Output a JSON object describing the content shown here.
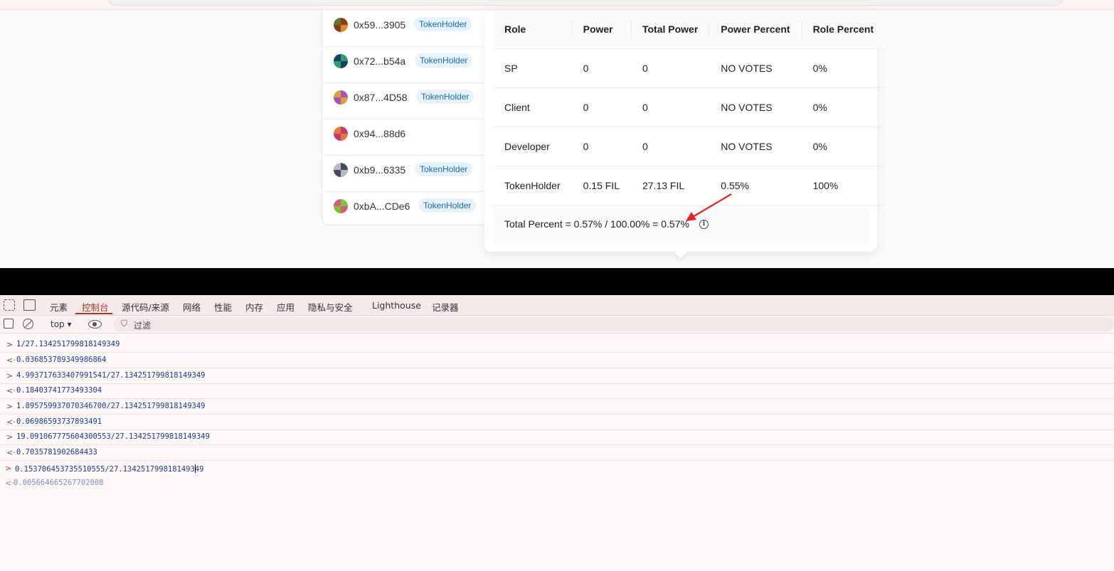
{
  "voters": [
    {
      "address": "0x59...3905",
      "role_badge": "TokenHolder",
      "avatar_color": "#8a3b1c"
    },
    {
      "address": "0x72...b54a",
      "role_badge": "TokenHolder",
      "avatar_color": "#2a9c6e"
    },
    {
      "address": "0x87...4D58",
      "role_badge": "TokenHolder",
      "avatar_color": "#b04fb8"
    },
    {
      "address": "0x94...88d6",
      "role_badge": "",
      "avatar_color": "#c23b6c"
    },
    {
      "address": "0xb9...6335",
      "role_badge": "TokenHolder",
      "avatar_color": "#444d5e"
    },
    {
      "address": "0xbA...CDe6",
      "role_badge": "TokenHolder",
      "avatar_color": "#7cc23b"
    }
  ],
  "power_table": {
    "headers": [
      "Role",
      "Power",
      "Total Power",
      "Power Percent",
      "Role Percent"
    ],
    "rows": [
      [
        "SP",
        "0",
        "0",
        "NO VOTES",
        "0%"
      ],
      [
        "Client",
        "0",
        "0",
        "NO VOTES",
        "0%"
      ],
      [
        "Developer",
        "0",
        "0",
        "NO VOTES",
        "0%"
      ],
      [
        "TokenHolder",
        "0.15 FIL",
        "27.13 FIL",
        "0.55%",
        "100%"
      ]
    ],
    "total_text": "Total Percent =  0.57% / 100.00% = 0.57%",
    "info_glyph": "i"
  },
  "devtools": {
    "tabs": [
      "元素",
      "控制台",
      "源代码/来源",
      "网络",
      "性能",
      "内存",
      "应用",
      "隐私与安全",
      "Lighthouse",
      "记录器"
    ],
    "active_tab": "控制台",
    "context": "top ▾",
    "filter_label": "过滤",
    "console_lines": [
      {
        "prefix": ">",
        "text": "1/27.134251799818149349"
      },
      {
        "prefix": "<·",
        "text": "0.036853789349986864"
      },
      {
        "prefix": ">",
        "text": "4.993717633407991541/27.134251799818149349"
      },
      {
        "prefix": "<·",
        "text": "0.18403741773493304"
      },
      {
        "prefix": ">",
        "text": "1.895759937070346700/27.134251799818149349"
      },
      {
        "prefix": "<·",
        "text": "0.06986593737893491"
      },
      {
        "prefix": ">",
        "text": "19.091067775604300553/27.134251799818149349"
      },
      {
        "prefix": "<·",
        "text": "0.7035781902684433"
      },
      {
        "prefix": ">",
        "text": "0.153706453735510555/27.134251799818149349"
      },
      {
        "prefix": "<·",
        "text": "0.005664665267702008"
      }
    ]
  },
  "colors": {
    "badge_text": "#1769a8",
    "badge_bg": "#e6f2fc",
    "active_tab": "#9c3a25",
    "annotation_arrow": "#e0261f"
  }
}
